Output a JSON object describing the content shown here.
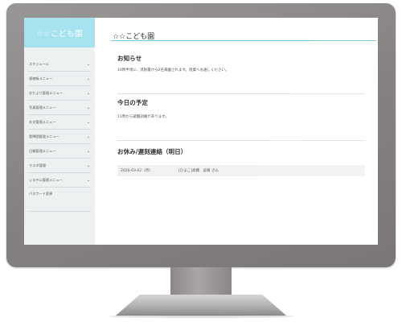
{
  "app": {
    "logo": "☆☆こども園",
    "page_title": "☆☆こども園"
  },
  "sidebar": {
    "items": [
      {
        "label": "スケジュール"
      },
      {
        "label": "連絡帳メニュー"
      },
      {
        "label": "おたより管理メニュー"
      },
      {
        "label": "写真管理メニュー"
      },
      {
        "label": "お欠管理メニュー"
      },
      {
        "label": "登降園管理メニュー"
      },
      {
        "label": "日報管理メニュー"
      },
      {
        "label": "マスタ管理"
      },
      {
        "label": "システム管理メニュー"
      }
    ],
    "password_label": "パスワード変更"
  },
  "notice": {
    "title": "お知らせ",
    "text": "10時半頃に、消防署から2名来園されます。授業へお通しください。"
  },
  "schedule": {
    "title": "今日の予定",
    "text": "11時から避難訓練があります。"
  },
  "absence": {
    "title": "お休み/遅刻連絡（明日）",
    "rows": [
      {
        "date": "2026-03-02（月）",
        "detail": "[ひよこ]高橋　諒真 さん"
      }
    ]
  }
}
